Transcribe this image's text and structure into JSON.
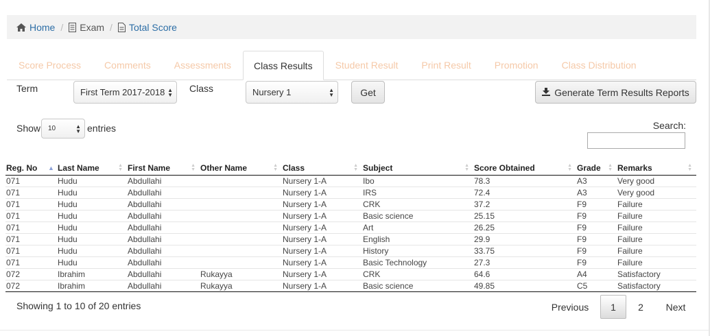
{
  "breadcrumb": {
    "home": "Home",
    "exam": "Exam",
    "total_score": "Total Score"
  },
  "tabs": [
    {
      "label": "Score Process",
      "active": false
    },
    {
      "label": "Comments",
      "active": false
    },
    {
      "label": "Assessments",
      "active": false
    },
    {
      "label": "Class Results",
      "active": true
    },
    {
      "label": "Student Result",
      "active": false
    },
    {
      "label": "Print Result",
      "active": false
    },
    {
      "label": "Promotion",
      "active": false
    },
    {
      "label": "Class Distribution",
      "active": false
    }
  ],
  "filters": {
    "term_label": "Term",
    "term_value": "First Term 2017-2018",
    "class_label": "Class",
    "class_value": "Nursery 1",
    "get_label": "Get",
    "generate_label": "Generate Term Results Reports"
  },
  "table_controls": {
    "show_label": "Show",
    "entries_value": "10",
    "entries_label": "entries",
    "search_label": "Search:",
    "search_value": ""
  },
  "table": {
    "columns": [
      "Reg. No",
      "Last Name",
      "First Name",
      "Other Name",
      "Class",
      "Subject",
      "Score Obtained",
      "Grade",
      "Remarks"
    ],
    "rows": [
      [
        "071",
        "Hudu",
        "Abdullahi",
        "",
        "Nursery 1-A",
        "Ibo",
        "78.3",
        "A3",
        "Very good"
      ],
      [
        "071",
        "Hudu",
        "Abdullahi",
        "",
        "Nursery 1-A",
        "IRS",
        "72.4",
        "A3",
        "Very good"
      ],
      [
        "071",
        "Hudu",
        "Abdullahi",
        "",
        "Nursery 1-A",
        "CRK",
        "37.2",
        "F9",
        "Failure"
      ],
      [
        "071",
        "Hudu",
        "Abdullahi",
        "",
        "Nursery 1-A",
        "Basic science",
        "25.15",
        "F9",
        "Failure"
      ],
      [
        "071",
        "Hudu",
        "Abdullahi",
        "",
        "Nursery 1-A",
        "Art",
        "26.25",
        "F9",
        "Failure"
      ],
      [
        "071",
        "Hudu",
        "Abdullahi",
        "",
        "Nursery 1-A",
        "English",
        "29.9",
        "F9",
        "Failure"
      ],
      [
        "071",
        "Hudu",
        "Abdullahi",
        "",
        "Nursery 1-A",
        "History",
        "33.75",
        "F9",
        "Failure"
      ],
      [
        "071",
        "Hudu",
        "Abdullahi",
        "",
        "Nursery 1-A",
        "Basic Technology",
        "27.3",
        "F9",
        "Failure"
      ],
      [
        "072",
        "Ibrahim",
        "Abdullahi",
        "Rukayya",
        "Nursery 1-A",
        "CRK",
        "64.6",
        "A4",
        "Satisfactory"
      ],
      [
        "072",
        "Ibrahim",
        "Abdullahi",
        "Rukayya",
        "Nursery 1-A",
        "Basic science",
        "49.85",
        "C5",
        "Satisfactory"
      ]
    ]
  },
  "footer": {
    "info": "Showing 1 to 10 of 20 entries",
    "previous": "Previous",
    "page1": "1",
    "page2": "2",
    "next": "Next"
  },
  "icons": {
    "home": "home-icon",
    "exam": "document-icon",
    "total_score": "document-icon",
    "download": "download-icon"
  }
}
